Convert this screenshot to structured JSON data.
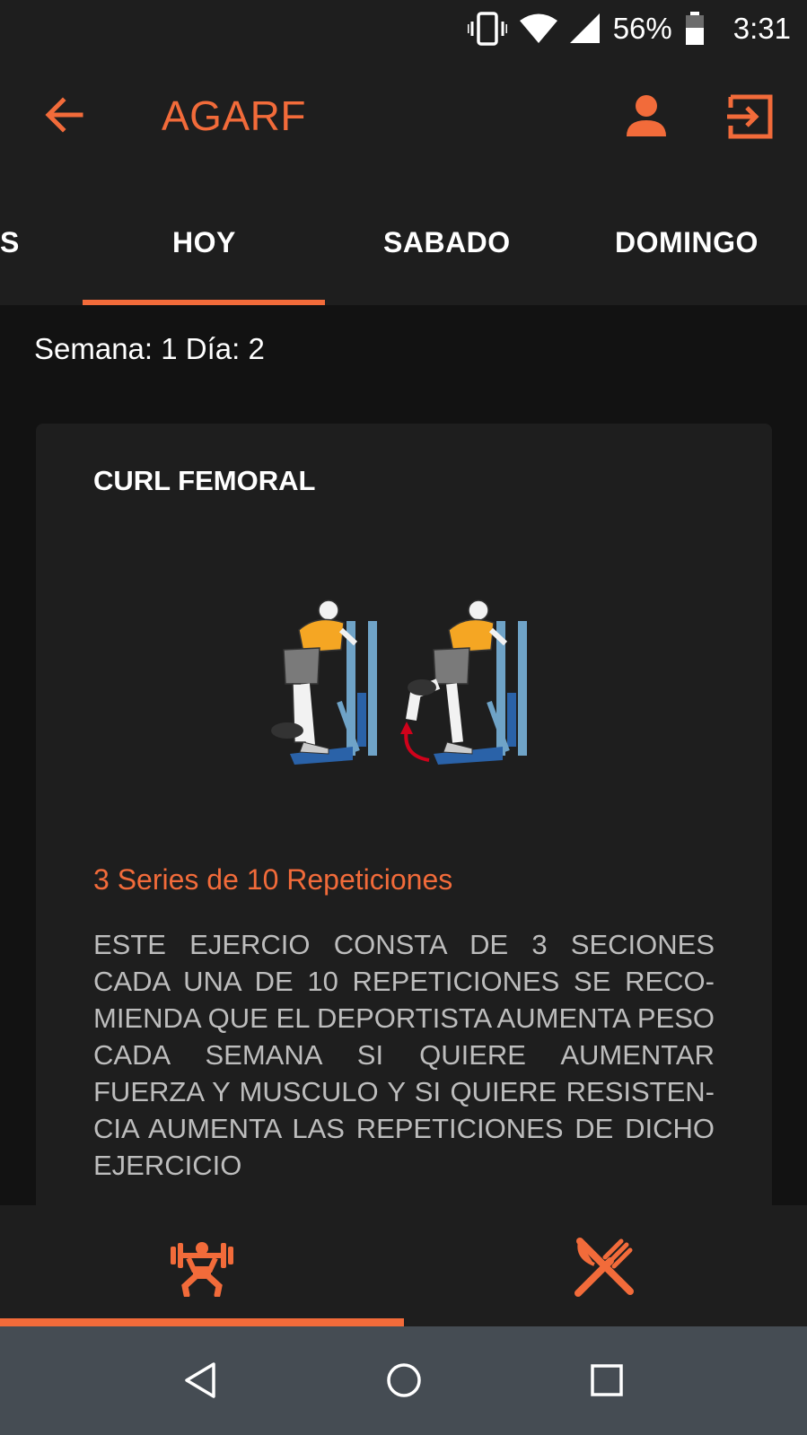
{
  "status_bar": {
    "battery": "56%",
    "time": "3:31",
    "icons": [
      "vibrate-icon",
      "wifi-icon",
      "signal-icon",
      "battery-icon"
    ]
  },
  "app_bar": {
    "title": "AGARF",
    "icons": [
      "back-arrow-icon",
      "person-icon",
      "logout-icon"
    ]
  },
  "tabs": [
    {
      "label": "S",
      "selected": false
    },
    {
      "label": "HOY",
      "selected": true
    },
    {
      "label": "SABADO",
      "selected": false
    },
    {
      "label": "DOMINGO",
      "selected": false
    }
  ],
  "week_info": "Semana: 1  Día: 2",
  "exercise": {
    "title": "CURL FEMORAL",
    "series": "3 Series de 10 Repeticiones",
    "description": "ESTE EJERCIO CONSTA DE 3 SECIONES CADA UNA DE 10 REPETICIONES SE RECO-MIENDA QUE EL DEPORTISTA AUMENTA PESO CADA SEMANA SI QUIERE AUMENTAR FUERZA Y MUSCULO Y SI QUIERE RESISTEN-CIA AUMENTA LAS REPETICIONES DE DICHO EJERCICIO"
  },
  "bottom_nav": {
    "items": [
      "weightlifting-icon",
      "fork-knife-icon"
    ],
    "selected_index": 0
  },
  "colors": {
    "accent": "#f26b3a",
    "background": "#121212",
    "surface": "#1e1e1e",
    "system_nav": "#454c53"
  }
}
